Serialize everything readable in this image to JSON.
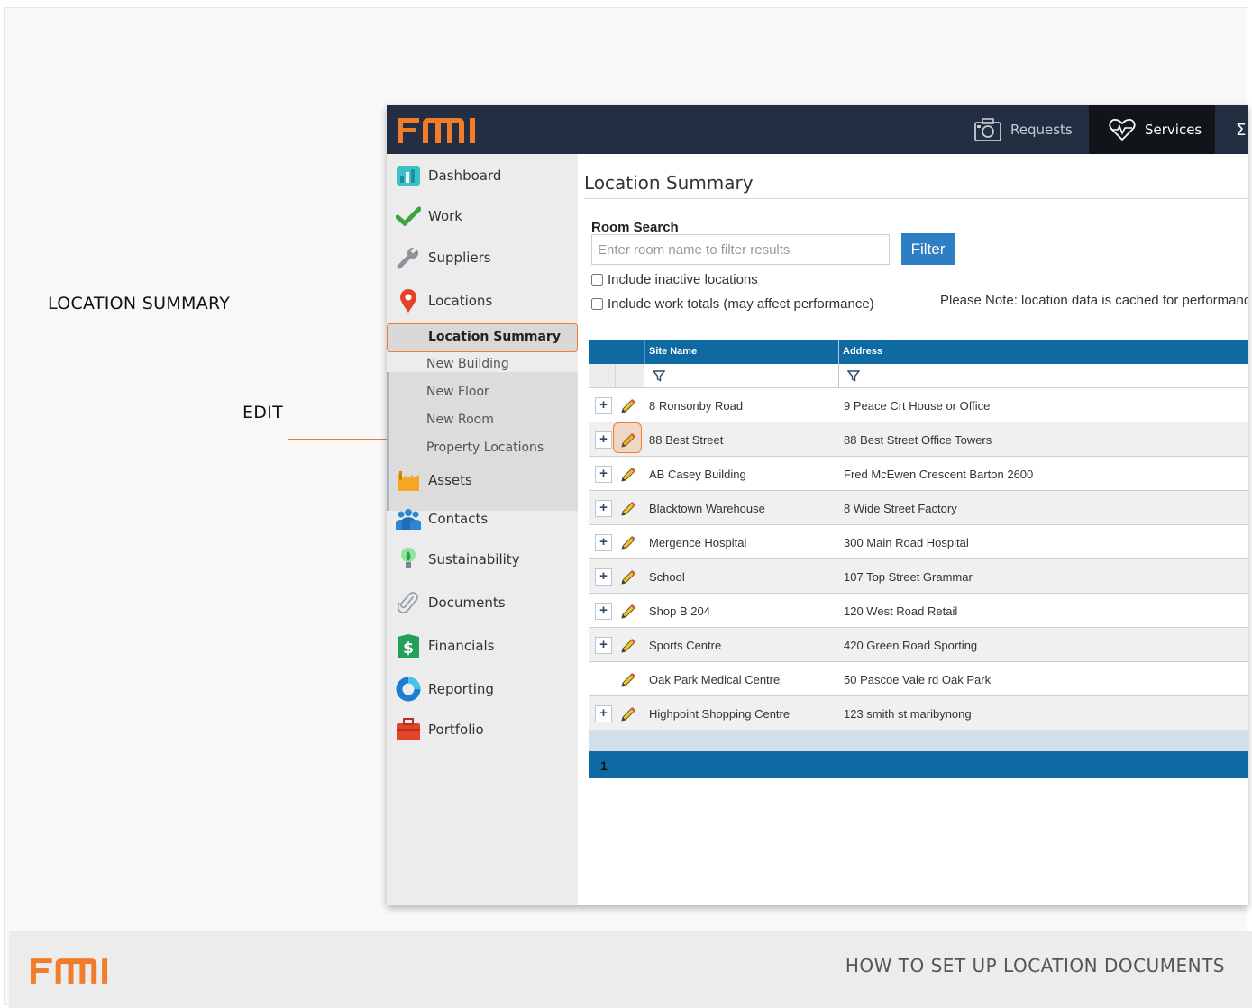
{
  "callouts": {
    "location_summary": "LOCATION SUMMARY",
    "edit": "EDIT"
  },
  "app": {
    "logo_text": "FMI",
    "brand_color": "#f07d2b",
    "topbar_color": "#232e42"
  },
  "topnav": {
    "requests": "Requests",
    "services": "Services"
  },
  "sidebar": {
    "items": [
      {
        "label": "Dashboard",
        "icon": "dashboard-icon"
      },
      {
        "label": "Work",
        "icon": "checkmark-icon"
      },
      {
        "label": "Suppliers",
        "icon": "wrench-icon"
      },
      {
        "label": "Locations",
        "icon": "map-pin-icon"
      },
      {
        "label": "Assets",
        "icon": "factory-icon"
      },
      {
        "label": "Contacts",
        "icon": "people-icon"
      },
      {
        "label": "Sustainability",
        "icon": "lightbulb-icon"
      },
      {
        "label": "Documents",
        "icon": "paperclip-icon"
      },
      {
        "label": "Financials",
        "icon": "dollar-icon"
      },
      {
        "label": "Reporting",
        "icon": "donut-chart-icon"
      },
      {
        "label": "Portfolio",
        "icon": "briefcase-icon"
      }
    ],
    "subitems": {
      "active": "Location Summary",
      "new_building": "New Building",
      "new_floor": "New Floor",
      "new_room": "New Room",
      "property_locations": "Property Locations"
    }
  },
  "main": {
    "title": "Location Summary",
    "room_search_label": "Room Search",
    "search_placeholder": "Enter room name to filter results",
    "filter_button": "Filter",
    "include_inactive": "Include inactive locations",
    "include_work_totals": "Include work totals (may affect performance)",
    "note": "Please Note: location data is cached for performanc"
  },
  "grid": {
    "columns": [
      "Site Name",
      "Address"
    ],
    "rows": [
      {
        "site": "8 Ronsonby Road",
        "address": "9 Peace Crt House or Office",
        "expandable": true
      },
      {
        "site": "88 Best Street",
        "address": "88 Best Street Office Towers",
        "expandable": true
      },
      {
        "site": "AB Casey Building",
        "address": "Fred McEwen Crescent Barton 2600",
        "expandable": true
      },
      {
        "site": "Blacktown Warehouse",
        "address": "8 Wide Street Factory",
        "expandable": true
      },
      {
        "site": "Mergence Hospital",
        "address": "300 Main Road Hospital",
        "expandable": true
      },
      {
        "site": "School",
        "address": "107 Top Street Grammar",
        "expandable": true
      },
      {
        "site": "Shop B 204",
        "address": "120 West Road Retail",
        "expandable": true
      },
      {
        "site": "Sports Centre",
        "address": "420 Green Road Sporting",
        "expandable": true
      },
      {
        "site": "Oak Park Medical Centre",
        "address": "50 Pascoe Vale rd Oak Park",
        "expandable": false
      },
      {
        "site": "Highpoint Shopping Centre",
        "address": "123 smith st maribynong",
        "expandable": true
      }
    ],
    "page": "1",
    "header_color": "#0f6aa3"
  },
  "footer": {
    "logo_text": "FMI",
    "title": "HOW TO SET UP LOCATION DOCUMENTS"
  }
}
